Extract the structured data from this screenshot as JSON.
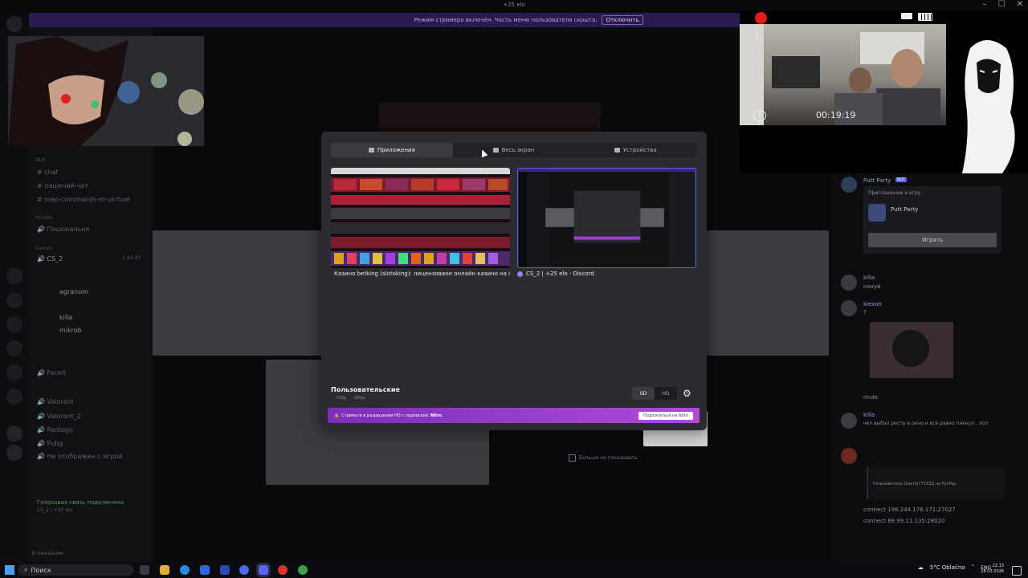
{
  "window": {
    "title": "+25 elo"
  },
  "banner": {
    "text": "Режим стримера включён. Часть меню пользователя скрыта.",
    "button": "Отключить"
  },
  "sidebar": {
    "categories": [
      "Text",
      "Private",
      "Games"
    ],
    "text_channels": [
      "chat",
      "пацючий-чат",
      "map-commands-m-ukrtoel"
    ],
    "private_channel": "Пацюкальня",
    "voice_channel": {
      "name": "CS_2",
      "time": "1:43:47"
    },
    "voice_users": [
      "agranom",
      "killa",
      "mikrob"
    ],
    "other_channels": [
      "Faceit",
      "Valorant",
      "Valorant_2",
      "Radiogo",
      "Pubg",
      "Не отображен с игрой"
    ],
    "voice_status": "Голосовая связь подключена",
    "voice_status_sub": "CS_2 / +25 elo",
    "user_status": "В ожидании"
  },
  "modal": {
    "tabs": [
      {
        "label": "Приложения",
        "active": true
      },
      {
        "label": "Весь экран",
        "active": false
      },
      {
        "label": "Устройства",
        "active": false
      }
    ],
    "sources": [
      {
        "label": "Казино betking (slotoking): лицензоване онлайн казино на гривні - ..."
      },
      {
        "label": "CS_2 | +25 elo - Discord"
      }
    ],
    "quality_title": "Пользовательские",
    "quality_resolution": "720p",
    "quality_fps": "30fps",
    "sd_label": "SD",
    "hd_label": "HD",
    "nitro_text": "Стримьте в разрешении HD с подпиской",
    "nitro_brand": "Nitro",
    "nitro_button": "Подписаться на Nitro"
  },
  "dont_show": "Больше не показывать",
  "chat": {
    "invite_title": "Putt Party",
    "invite_bot": "BOT",
    "invite_label": "Приглашение в игру",
    "invite_game": "Putt Party",
    "invite_button": "Играть",
    "messages": [
      {
        "user": "killa",
        "text": "нахуй"
      },
      {
        "user": "klexon",
        "text": "?"
      },
      {
        "user": "",
        "text": "mute"
      },
      {
        "user": "killa",
        "text": "чел выбал респу в окно и всё равно пакнул , лол"
      },
      {
        "user": "",
        "text": "connect 198.244.176.171:27027"
      },
      {
        "user": "",
        "text": "connect 88.99.11.135:28020"
      }
    ],
    "profile_link": "Пользователь Qwerty777ZZZ на FunPay"
  },
  "webcam": {
    "timer": "00:19:19"
  },
  "taskbar": {
    "search": "Поиск",
    "weather": "5°C Oblačno",
    "lang": "ENG",
    "time": "22:13",
    "date": "28.03.2026"
  },
  "colors": {
    "accent": "#5865f2",
    "nitro": "#9b3fcf",
    "rec": "#e51b1b",
    "modal_bg": "#2b2b31"
  }
}
